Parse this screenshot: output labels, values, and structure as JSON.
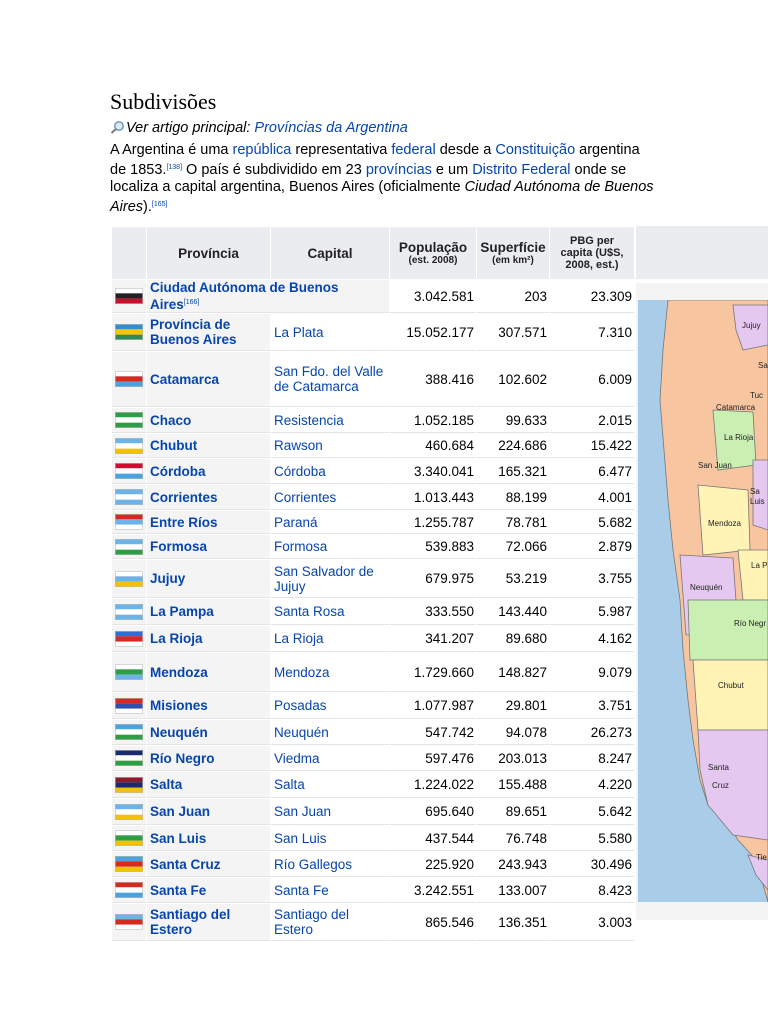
{
  "heading": "Subdivisões",
  "see_also": {
    "prefix": "Ver artigo principal: ",
    "link": "Províncias da Argentina"
  },
  "intro": {
    "t1": "A Argentina é uma ",
    "l1": "república",
    "t2": " representativa ",
    "l2": "federal",
    "t3": " desde a ",
    "l3": "Constituição",
    "t4": " argentina de 1853.",
    "ref1": "[138]",
    "t5": " O país é subdividido em 23 ",
    "l4": "províncias",
    "t6": " e um ",
    "l5": "Distrito Federal",
    "t7": " onde se localiza a capital argentina, Buenos Aires (oficialmente ",
    "italic": "Ciudad Autónoma de Buenos Aires",
    "t8": ").",
    "ref2": "[165]"
  },
  "table": {
    "headers": {
      "provincia": "Província",
      "capital": "Capital",
      "populacao": "População",
      "populacao_sub": "(est. 2008)",
      "superficie": "Superfície",
      "superficie_sub": "(em km²)",
      "pbg": "PBG per capita (U$S, 2008, est.)"
    },
    "rows": [
      {
        "province": "Ciudad Autónoma de Buenos Aires",
        "ref": "[166]",
        "capital": "",
        "population": "3.042.581",
        "area": "203",
        "gdp": "23.309",
        "flag_colors": [
          "#ffffff",
          "#222222",
          "#c8102e"
        ]
      },
      {
        "province": "Província de Buenos Aires",
        "ref": "",
        "capital": "La Plata",
        "population": "15.052.177",
        "area": "307.571",
        "gdp": "7.310",
        "flag_colors": [
          "#2f8fd0",
          "#f7c600",
          "#2e8b57"
        ]
      },
      {
        "province": "Catamarca",
        "ref": "",
        "capital": "San Fdo. del Valle de Catamarca",
        "population": "388.416",
        "area": "102.602",
        "gdp": "6.009",
        "flag_colors": [
          "#ffffff",
          "#d52b1e",
          "#4aa3df"
        ]
      },
      {
        "province": "Chaco",
        "ref": "",
        "capital": "Resistencia",
        "population": "1.052.185",
        "area": "99.633",
        "gdp": "2.015",
        "flag_colors": [
          "#2e9e44",
          "#ffffff",
          "#2e9e44"
        ]
      },
      {
        "province": "Chubut",
        "ref": "",
        "capital": "Rawson",
        "population": "460.684",
        "area": "224.686",
        "gdp": "15.422",
        "flag_colors": [
          "#6cb4e8",
          "#ffffff",
          "#f2c200"
        ]
      },
      {
        "province": "Córdoba",
        "ref": "",
        "capital": "Córdoba",
        "population": "3.340.041",
        "area": "165.321",
        "gdp": "6.477",
        "flag_colors": [
          "#c8102e",
          "#ffffff",
          "#4aa3df"
        ]
      },
      {
        "province": "Corrientes",
        "ref": "",
        "capital": "Corrientes",
        "population": "1.013.443",
        "area": "88.199",
        "gdp": "4.001",
        "flag_colors": [
          "#6cb4e8",
          "#ffffff",
          "#6cb4e8"
        ]
      },
      {
        "province": "Entre Ríos",
        "ref": "",
        "capital": "Paraná",
        "population": "1.255.787",
        "area": "78.781",
        "gdp": "5.682",
        "flag_colors": [
          "#d52b1e",
          "#6cb4e8",
          "#ffffff"
        ]
      },
      {
        "province": "Formosa",
        "ref": "",
        "capital": "Formosa",
        "population": "539.883",
        "area": "72.066",
        "gdp": "2.879",
        "flag_colors": [
          "#6cb4e8",
          "#ffffff",
          "#2e9e44"
        ]
      },
      {
        "province": "Jujuy",
        "ref": "",
        "capital": "San Salvador de Jujuy",
        "population": "679.975",
        "area": "53.219",
        "gdp": "3.755",
        "flag_colors": [
          "#ffffff",
          "#6cb4e8",
          "#f2c200"
        ]
      },
      {
        "province": "La Pampa",
        "ref": "",
        "capital": "Santa Rosa",
        "population": "333.550",
        "area": "143.440",
        "gdp": "5.987",
        "flag_colors": [
          "#6cb4e8",
          "#ffffff",
          "#6cb4e8"
        ]
      },
      {
        "province": "La Rioja",
        "ref": "",
        "capital": "La Rioja",
        "population": "341.207",
        "area": "89.680",
        "gdp": "4.162",
        "flag_colors": [
          "#2f6fd0",
          "#d52b1e",
          "#ffffff"
        ]
      },
      {
        "province": "Mendoza",
        "ref": "",
        "capital": "Mendoza",
        "population": "1.729.660",
        "area": "148.827",
        "gdp": "9.079",
        "flag_colors": [
          "#ffffff",
          "#2e9e44",
          "#6cb4e8"
        ]
      },
      {
        "province": "Misiones",
        "ref": "",
        "capital": "Posadas",
        "population": "1.077.987",
        "area": "29.801",
        "gdp": "3.751",
        "flag_colors": [
          "#d52b1e",
          "#2f4fb0",
          "#ffffff"
        ]
      },
      {
        "province": "Neuquén",
        "ref": "",
        "capital": "Neuquén",
        "population": "547.742",
        "area": "94.078",
        "gdp": "26.273",
        "flag_colors": [
          "#4aa3df",
          "#ffffff",
          "#2e9e44"
        ]
      },
      {
        "province": "Río Negro",
        "ref": "",
        "capital": "Viedma",
        "population": "597.476",
        "area": "203.013",
        "gdp": "8.247",
        "flag_colors": [
          "#1a2a6c",
          "#ffffff",
          "#2e9e44"
        ]
      },
      {
        "province": "Salta",
        "ref": "",
        "capital": "Salta",
        "population": "1.224.022",
        "area": "155.488",
        "gdp": "4.220",
        "flag_colors": [
          "#8b1a2b",
          "#1a2a6c",
          "#f2c200"
        ]
      },
      {
        "province": "San Juan",
        "ref": "",
        "capital": "San Juan",
        "population": "695.640",
        "area": "89.651",
        "gdp": "5.642",
        "flag_colors": [
          "#6cb4e8",
          "#ffffff",
          "#f2c200"
        ]
      },
      {
        "province": "San Luis",
        "ref": "",
        "capital": "San Luis",
        "population": "437.544",
        "area": "76.748",
        "gdp": "5.580",
        "flag_colors": [
          "#ffffff",
          "#2e9e44",
          "#f2c200"
        ]
      },
      {
        "province": "Santa Cruz",
        "ref": "",
        "capital": "Río Gallegos",
        "population": "225.920",
        "area": "243.943",
        "gdp": "30.496",
        "flag_colors": [
          "#4aa3df",
          "#d52b1e",
          "#f2c200"
        ]
      },
      {
        "province": "Santa Fe",
        "ref": "",
        "capital": "Santa Fe",
        "population": "3.242.551",
        "area": "133.007",
        "gdp": "8.423",
        "flag_colors": [
          "#d52b1e",
          "#ffffff",
          "#4aa3df"
        ]
      },
      {
        "province": "Santiago del Estero",
        "ref": "",
        "capital": "Santiago del Estero",
        "population": "865.546",
        "area": "136.351",
        "gdp": "3.003",
        "flag_colors": [
          "#6cb4e8",
          "#d52b1e",
          "#ffffff"
        ]
      }
    ]
  },
  "map": {
    "labels": [
      "Jujuy",
      "Sa",
      "Tuc",
      "Catamarca",
      "La Rioja",
      "San Juan",
      "Sa",
      "Luis",
      "Mendoza",
      "La Pa",
      "Neuquén",
      "Río Negr",
      "Chubut",
      "Santa",
      "Cruz",
      "Tie"
    ],
    "colors": {
      "water": "#a9cde8",
      "land_a": "#f7c59f",
      "land_b": "#e4c8f0",
      "land_c": "#fff4b5",
      "land_d": "#c9efb3",
      "border": "#777777"
    }
  }
}
